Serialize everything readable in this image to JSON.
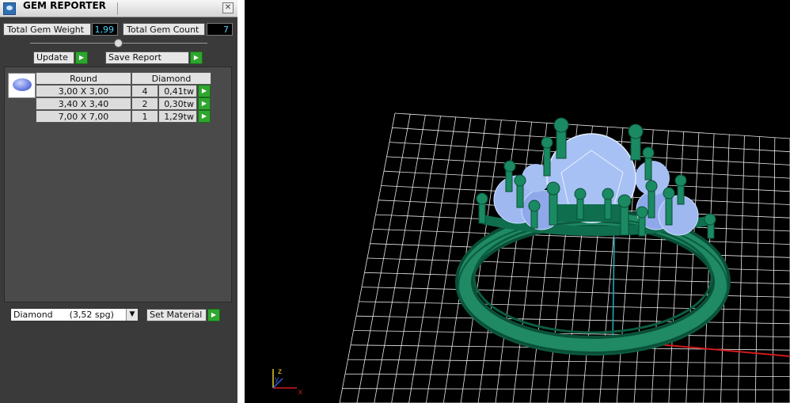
{
  "window": {
    "title": "GEM REPORTER",
    "close_glyph": "✕"
  },
  "stats": {
    "weight_label": "Total Gem Weight",
    "weight_value": "1,99",
    "count_label": "Total Gem Count",
    "count_value": "7"
  },
  "buttons": {
    "update": "Update",
    "save_report": "Save Report",
    "set_material": "Set Material"
  },
  "table": {
    "headers": [
      "Round",
      "Diamond"
    ],
    "rows": [
      {
        "size": "3,00 X 3,00",
        "count": "4",
        "weight": "0,41tw"
      },
      {
        "size": "3,40 X 3,40",
        "count": "2",
        "weight": "0,30tw"
      },
      {
        "size": "7,00 X 7,00",
        "count": "1",
        "weight": "1,29tw"
      }
    ]
  },
  "material": {
    "selected": "Diamond      (3,52 spg)"
  },
  "viewport": {
    "axis_labels": {
      "x": "x",
      "y": "y",
      "z": "z"
    },
    "colors": {
      "background": "#000000",
      "grid": "#e8e8e8",
      "ring_metal": "#0f6e4e",
      "gem": "#9fb8f0",
      "x_axis": "#d11a1a",
      "y_axis": "#20b0c0"
    }
  },
  "icons": {
    "arrow": "play-arrow-icon",
    "dropdown": "chevron-down-icon",
    "app": "gem-reporter-app-icon"
  }
}
